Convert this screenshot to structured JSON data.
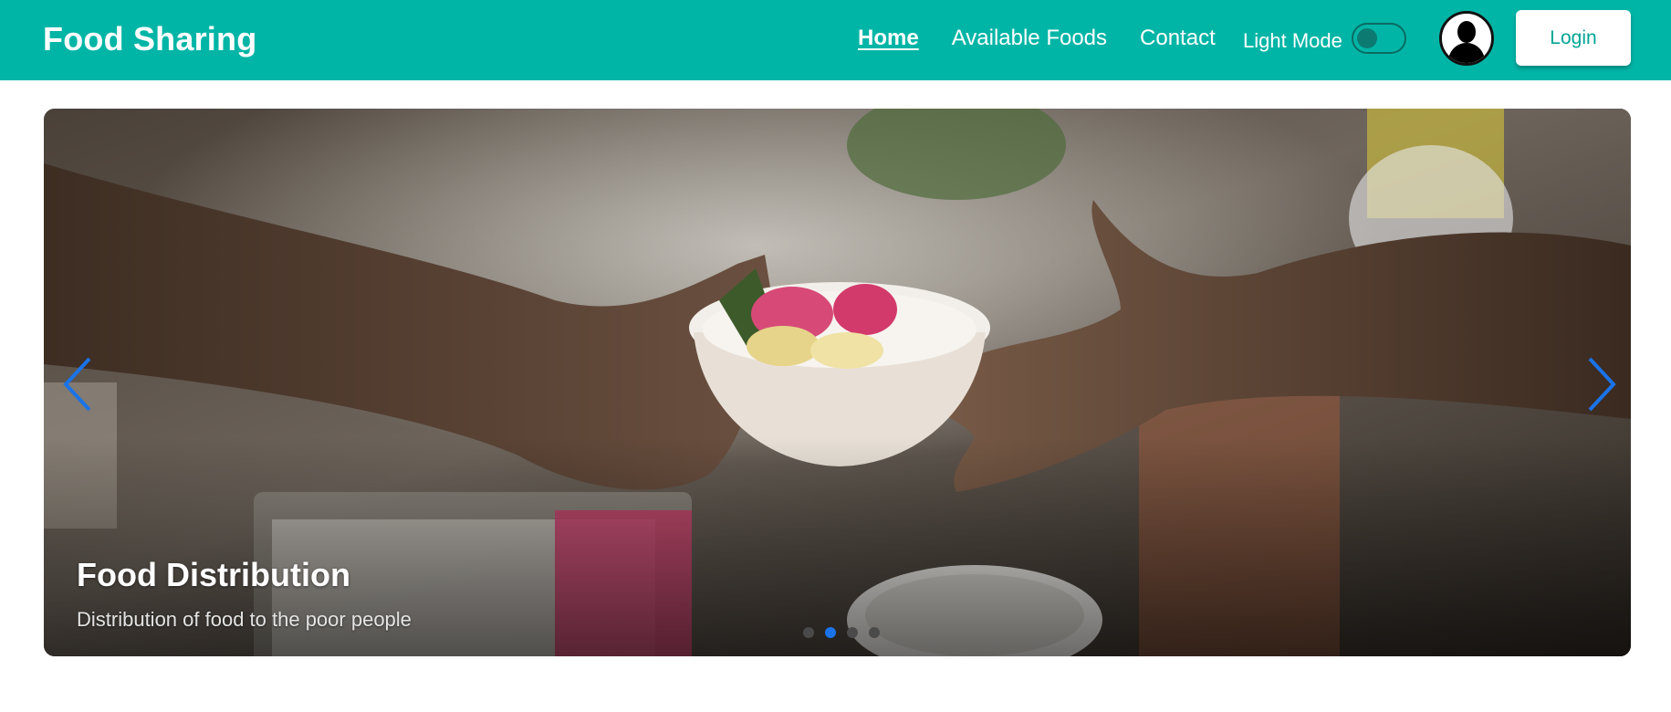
{
  "header": {
    "brand": "Food Sharing",
    "nav": [
      {
        "label": "Home",
        "active": true
      },
      {
        "label": "Available Foods",
        "active": false
      },
      {
        "label": "Contact",
        "active": false
      }
    ],
    "mode_label": "Light Mode",
    "login_label": "Login"
  },
  "carousel": {
    "caption_title": "Food Distribution",
    "caption_subtitle": "Distribution of food to the poor people",
    "slide_count": 4,
    "active_slide": 2
  },
  "colors": {
    "header_bg": "#00b5a6",
    "accent": "#1a73e8"
  }
}
